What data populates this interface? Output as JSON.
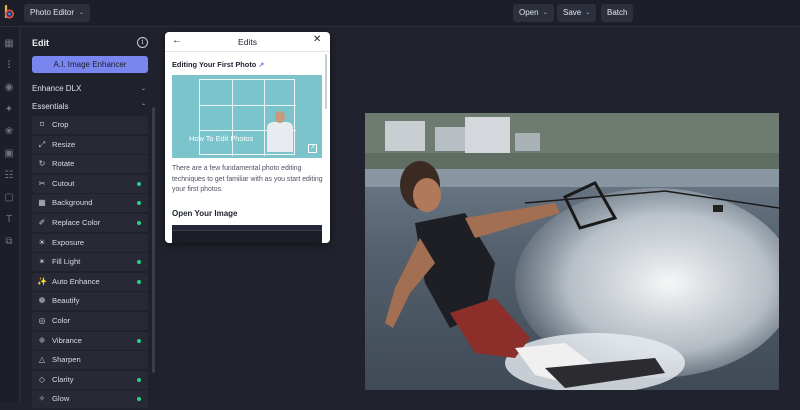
{
  "topbar": {
    "app_menu": "Photo Editor",
    "open": "Open",
    "save": "Save",
    "batch": "Batch"
  },
  "rail": {
    "icons": [
      "grid-icon",
      "sliders-icon",
      "eye-icon",
      "effects-icon",
      "sticker-icon",
      "frame-icon",
      "layout-icon",
      "crop-frame-icon",
      "text-icon",
      "overlay-icon"
    ]
  },
  "panel": {
    "title": "Edit",
    "ai_button": "A.I. Image Enhancer",
    "section_enhance": "Enhance DLX",
    "section_essentials": "Essentials",
    "tools": [
      {
        "label": "Crop",
        "icon": "crop-icon",
        "new": false
      },
      {
        "label": "Resize",
        "icon": "resize-icon",
        "new": false
      },
      {
        "label": "Rotate",
        "icon": "rotate-icon",
        "new": false
      },
      {
        "label": "Cutout",
        "icon": "scissors-icon",
        "new": true
      },
      {
        "label": "Background",
        "icon": "background-icon",
        "new": true
      },
      {
        "label": "Replace Color",
        "icon": "dropper-icon",
        "new": true
      },
      {
        "label": "Exposure",
        "icon": "exposure-icon",
        "new": false
      },
      {
        "label": "Fill Light",
        "icon": "bulb-icon",
        "new": true
      },
      {
        "label": "Auto Enhance",
        "icon": "magic-wand-icon",
        "new": true
      },
      {
        "label": "Beautify",
        "icon": "beautify-icon",
        "new": false
      },
      {
        "label": "Color",
        "icon": "palette-icon",
        "new": false
      },
      {
        "label": "Vibrance",
        "icon": "vibrance-icon",
        "new": true
      },
      {
        "label": "Sharpen",
        "icon": "triangle-icon",
        "new": false
      },
      {
        "label": "Clarity",
        "icon": "diamond-icon",
        "new": true
      },
      {
        "label": "Glow",
        "icon": "glow-icon",
        "new": true
      }
    ],
    "new_dot_color": "#29d08a",
    "accent_color": "#7a86f0"
  },
  "popup": {
    "title": "Edits",
    "subtitle": "Editing Your First Photo",
    "thumb_caption": "How To Edit Photos",
    "body": "There are a few fundamental photo editing techniques to get familiar with as you start editing your first photos.",
    "heading": "Open Your Image"
  }
}
